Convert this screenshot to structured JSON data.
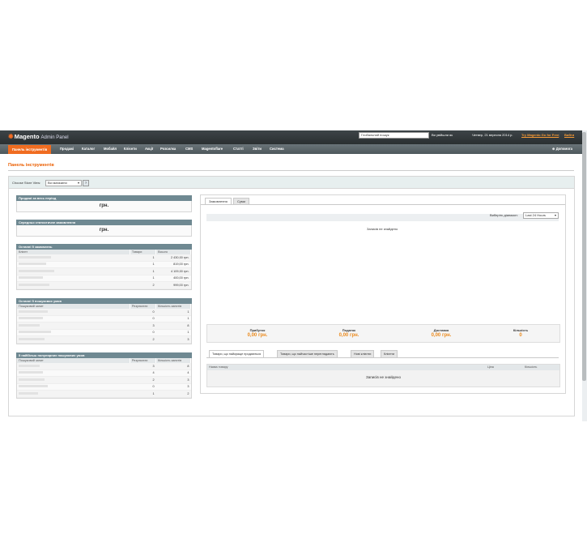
{
  "header": {
    "logo_brand": "Magento",
    "logo_suffix": "Admin Panel",
    "search_placeholder": "Глобальний пошук",
    "logged_in": "Ви увійшли як",
    "date": "Четвер, 21 вересня 2014 р.",
    "try_link": "Try Magento Go for Free",
    "logout": "Вийти"
  },
  "nav": {
    "items": [
      "Панель інструментів",
      "Продажі",
      "Каталог",
      "Мобайл",
      "Клієнти",
      "Акції",
      "Розсилка",
      "CMS",
      "Magentoflare",
      "Статті",
      "Звіти",
      "Система"
    ],
    "help": "Допомога"
  },
  "page": {
    "title": "Панель інструментів",
    "scope_label": "Choose Store View:",
    "scope_value": "Всі магазини",
    "scope_help": "?"
  },
  "left": {
    "lifetime_sales_title": "Продажі за весь період",
    "lifetime_sales_value": "грн.",
    "avg_order_title": "Середньо статистичне замовлення",
    "avg_order_value": "грн.",
    "last_orders_title": "Останні 5 замовлень",
    "last_orders_cols": [
      "Клієнт",
      "Товари",
      "Всього"
    ],
    "last_orders": [
      {
        "items": "1",
        "total": "2 430,00 грн."
      },
      {
        "items": "1",
        "total": "819,00 грн."
      },
      {
        "items": "1",
        "total": "4 109,00 грн."
      },
      {
        "items": "1",
        "total": "400,00 грн."
      },
      {
        "items": "2",
        "total": "999,00 грн."
      }
    ],
    "last_search_title": "Останні 5 пошукових умов",
    "search_cols": [
      "Пошуковий запит",
      "Результати",
      "Кількість запитів"
    ],
    "last_search": [
      {
        "results": "0",
        "uses": "1"
      },
      {
        "results": "0",
        "uses": "1"
      },
      {
        "results": "3",
        "uses": "8"
      },
      {
        "results": "0",
        "uses": "1"
      },
      {
        "results": "2",
        "uses": "3"
      }
    ],
    "top_search_title": "5 найбільш популярних пошукових умов",
    "top_search": [
      {
        "results": "3",
        "uses": "8"
      },
      {
        "results": "4",
        "uses": "4"
      },
      {
        "results": "2",
        "uses": "3"
      },
      {
        "results": "0",
        "uses": "3"
      },
      {
        "results": "1",
        "uses": "2"
      }
    ]
  },
  "right": {
    "tabs": [
      "Замовлення",
      "Суми"
    ],
    "period_label": "Виберіть діапазон:",
    "period_value": "Last 24 Hours",
    "no_records": "Записів не знайдено",
    "totals": [
      {
        "label": "Прибуток",
        "value": "0,00 грн."
      },
      {
        "label": "Податок",
        "value": "0,00 грн."
      },
      {
        "label": "Доставка",
        "value": "0,00 грн."
      },
      {
        "label": "Кількість",
        "value": "0"
      }
    ],
    "bottom_tabs": [
      "Товари, що найкраще продаються",
      "Товари, що найчастіше переглядають",
      "Нові клієнти",
      "Клієнти"
    ],
    "bottom_cols": [
      "Назва товару",
      "Ціна",
      "Кількість"
    ],
    "bottom_no_records": "Записів не знайдено"
  }
}
